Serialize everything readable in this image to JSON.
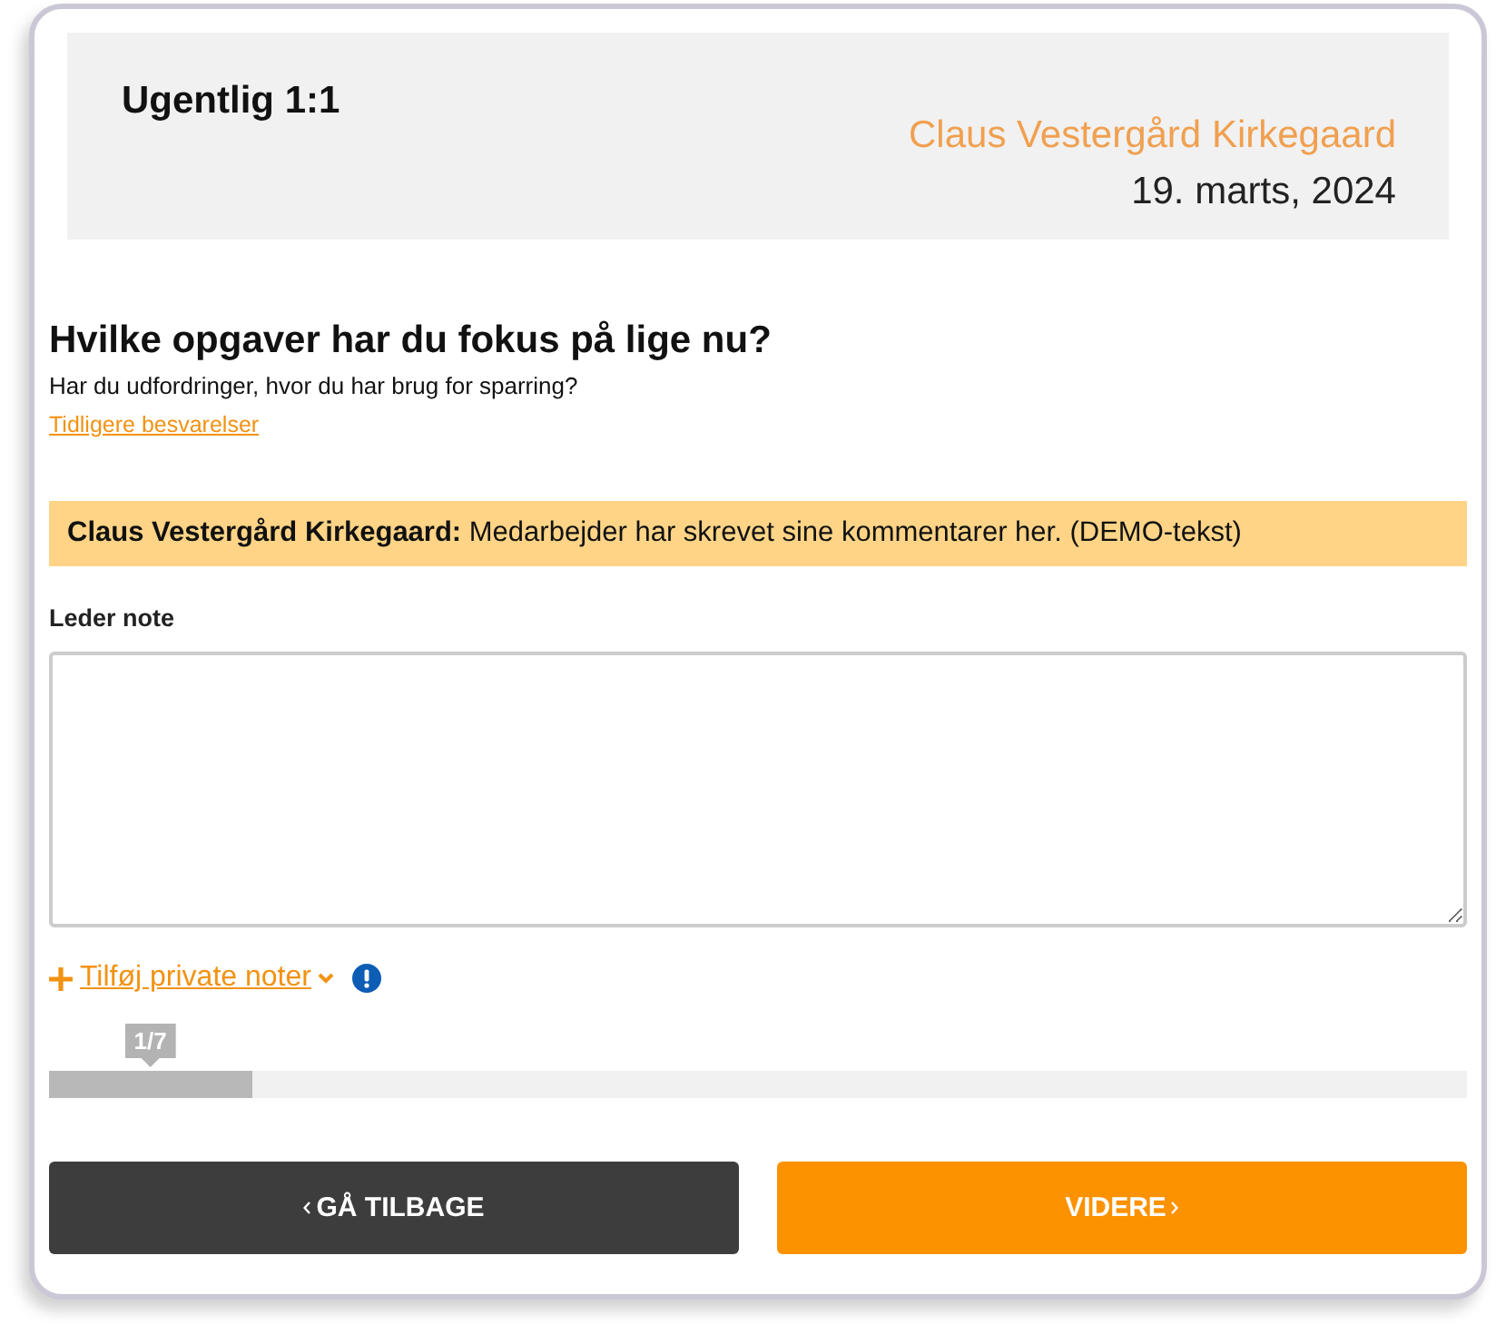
{
  "header": {
    "title": "Ugentlig 1:1",
    "person": "Claus Vestergård Kirkegaard",
    "date": "19. marts, 2024"
  },
  "question": {
    "title": "Hvilke opgaver har du fokus på lige nu?",
    "subtitle": "Har du udfordringer, hvor du har brug for sparring?",
    "history_link": "Tidligere besvarelser"
  },
  "employee_comment": "**Claus Vestergård Kirkegaard:** Medarbejder har skrevet sine kommentarer her. (DEMO-tekst)",
  "manager_note": {
    "label": "Leder note"
  },
  "private_notes": {
    "label": "Tilføj private noter",
    "expanded": false
  },
  "progress": {
    "reading": "1/7",
    "level": 0.143
  },
  "buttons": [
    {
      "kind": "back",
      "label": "GÅ TILBAGE"
    },
    {
      "kind": "next",
      "label": "VIDERE"
    }
  ]
}
